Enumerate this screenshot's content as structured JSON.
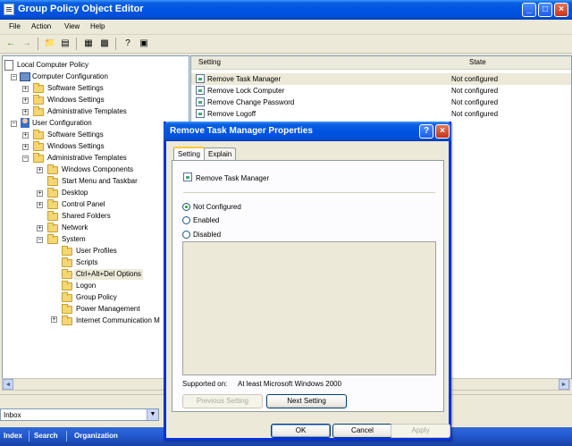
{
  "window": {
    "title": "Group Policy Object Editor"
  },
  "menu": [
    "File",
    "Action",
    "View",
    "Help"
  ],
  "tree": [
    {
      "label": "Local Computer Policy",
      "icon": "document-icon"
    },
    {
      "label": "Computer Configuration",
      "icon": "computer-icon"
    },
    {
      "label": "Software Settings",
      "icon": "folder-icon"
    },
    {
      "label": "Windows Settings",
      "icon": "folder-icon"
    },
    {
      "label": "Administrative Templates",
      "icon": "folder-icon"
    },
    {
      "label": "User Configuration",
      "icon": "user-icon"
    },
    {
      "label": "Software Settings",
      "icon": "folder-icon"
    },
    {
      "label": "Windows Settings",
      "icon": "folder-icon"
    },
    {
      "label": "Administrative Templates",
      "icon": "folder-icon"
    },
    {
      "label": "Windows Components",
      "icon": "folder-icon"
    },
    {
      "label": "Start Menu and Taskbar",
      "icon": "folder-icon"
    },
    {
      "label": "Desktop",
      "icon": "folder-icon"
    },
    {
      "label": "Control Panel",
      "icon": "folder-icon"
    },
    {
      "label": "Shared Folders",
      "icon": "folder-icon"
    },
    {
      "label": "Network",
      "icon": "folder-icon"
    },
    {
      "label": "System",
      "icon": "folder-icon"
    },
    {
      "label": "User Profiles",
      "icon": "folder-icon"
    },
    {
      "label": "Scripts",
      "icon": "folder-icon"
    },
    {
      "label": "Ctrl+Alt+Del Options",
      "icon": "folder-icon"
    },
    {
      "label": "Logon",
      "icon": "folder-icon"
    },
    {
      "label": "Group Policy",
      "icon": "folder-icon"
    },
    {
      "label": "Power Management",
      "icon": "folder-icon"
    },
    {
      "label": "Internet Communication M",
      "icon": "folder-icon"
    }
  ],
  "list": {
    "headers": [
      "Setting",
      "State"
    ],
    "rows": [
      {
        "setting": "Remove Task Manager",
        "state": "Not configured"
      },
      {
        "setting": "Remove Lock Computer",
        "state": "Not configured"
      },
      {
        "setting": "Remove Change Password",
        "state": "Not configured"
      },
      {
        "setting": "Remove Logoff",
        "state": "Not configured"
      }
    ]
  },
  "dialog": {
    "title": "Remove Task Manager Properties",
    "tabs": [
      "Setting",
      "Explain"
    ],
    "policy_name": "Remove Task Manager",
    "options": [
      "Not Configured",
      "Enabled",
      "Disabled"
    ],
    "selected_option": "Not Configured",
    "supported_label": "Supported on:",
    "supported_value": "At least Microsoft Windows 2000",
    "prev_button": "Previous Setting",
    "next_button": "Next Setting",
    "ok_button": "OK",
    "cancel_button": "Cancel",
    "apply_button": "Apply"
  },
  "inbox": {
    "value": "Inbox"
  },
  "taskbar": [
    "Index",
    "Search",
    "Organization"
  ]
}
